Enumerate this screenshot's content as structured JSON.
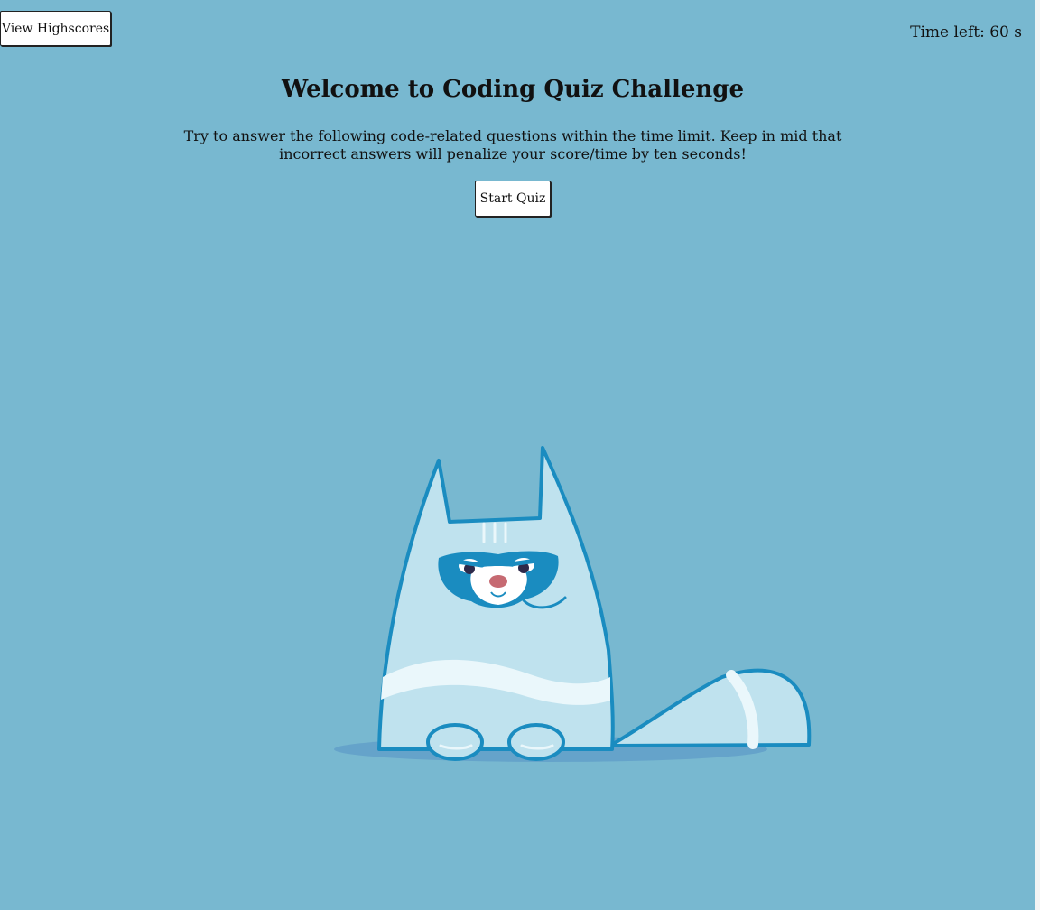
{
  "header": {
    "highscores_label": "View Highscores",
    "timer_text": "Time left: 60 s"
  },
  "main": {
    "title": "Welcome to Coding Quiz Challenge",
    "intro": "Try to answer the following code-related questions within the time limit. Keep in mid that incorrect answers will penalize your score/time by ten seconds!",
    "start_label": "Start Quiz"
  },
  "illustration": {
    "icon": "grumpy-cat-illustration"
  },
  "colors": {
    "background": "#78b8d0",
    "button_bg": "#ffffff",
    "text": "#111111",
    "cat_body": "#bfe2ee",
    "cat_outline": "#1a8cc0"
  }
}
